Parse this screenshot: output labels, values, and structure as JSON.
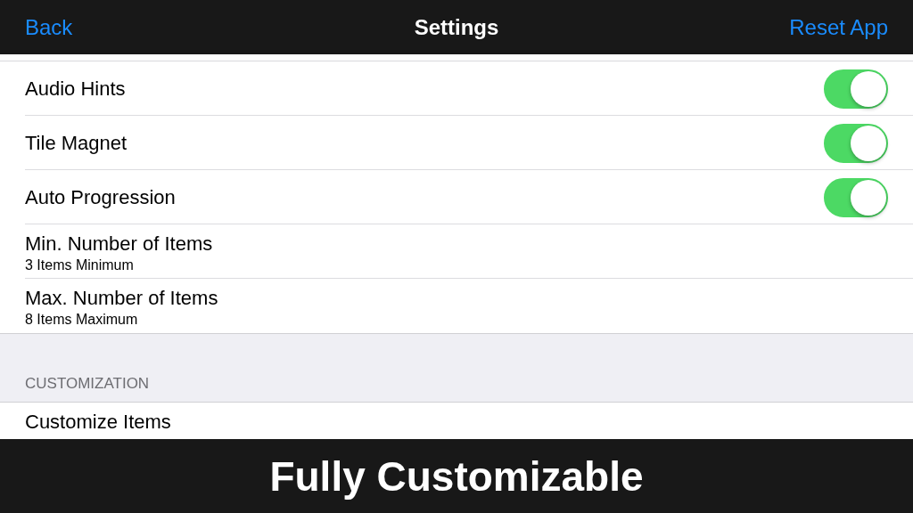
{
  "nav": {
    "back": "Back",
    "title": "Settings",
    "action": "Reset App"
  },
  "sections": [
    {
      "rows": [
        {
          "kind": "toggle",
          "title": "Audio Hints",
          "on": true
        },
        {
          "kind": "toggle",
          "title": "Tile Magnet",
          "on": true
        },
        {
          "kind": "toggle",
          "title": "Auto Progression",
          "on": true
        },
        {
          "kind": "detail",
          "title": "Min. Number of Items",
          "subtitle": "3 Items Minimum"
        },
        {
          "kind": "detail",
          "title": "Max. Number of Items",
          "subtitle": "8 Items Maximum"
        }
      ]
    },
    {
      "header": "CUSTOMIZATION",
      "rows": [
        {
          "kind": "detail",
          "title": "Customize Items"
        }
      ]
    }
  ],
  "banner": {
    "caption": "Fully Customizable"
  }
}
